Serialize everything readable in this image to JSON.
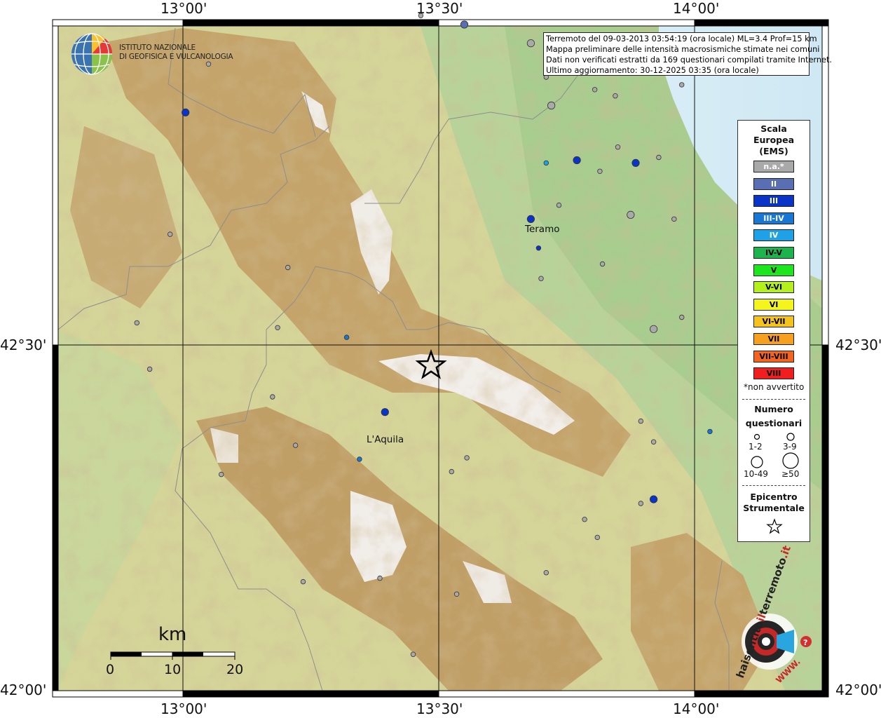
{
  "header": {
    "lines": [
      "Terremoto del 09-03-2013 03:54:19 (ora locale) ML=3.4 Prof=15 km",
      "Mappa preliminare delle intensità macrosismiche stimate nei comuni",
      "Dati non verificati estratti da 169 questionari compilati tramite Internet.",
      "Ultimo aggiornamento: 30-12-2025 03:35 (ora locale)"
    ]
  },
  "institute": {
    "line1": "ISTITUTO NAZIONALE",
    "line2": "DI GEOFISICA E VULCANOLOGIA"
  },
  "axes": {
    "top": [
      "13°00'",
      "13°30'",
      "14°00'"
    ],
    "bottom": [
      "13°00'",
      "13°30'",
      "14°00'"
    ],
    "left": [
      "42°30'",
      "42°00'"
    ],
    "right": [
      "42°30'",
      "42°00'"
    ]
  },
  "cities": [
    {
      "name": "Teramo",
      "lon": 13.703,
      "lat": 42.658
    },
    {
      "name": "L'Aquila",
      "lon": 13.397,
      "lat": 42.35
    }
  ],
  "epicenter": {
    "lon": 13.485,
    "lat": 42.47
  },
  "legend": {
    "scale_title": [
      "Scala",
      "Europea",
      "(EMS)"
    ],
    "classes": [
      {
        "label": "n.a.*",
        "color": "#a9a9a9",
        "text": "#ffffff"
      },
      {
        "label": "II",
        "color": "#5a6eb3",
        "text": "#ffffff"
      },
      {
        "label": "III",
        "color": "#0a34c8",
        "text": "#ffffff"
      },
      {
        "label": "III-IV",
        "color": "#1976d2",
        "text": "#ffffff"
      },
      {
        "label": "IV",
        "color": "#1ea1e6",
        "text": "#ffffff"
      },
      {
        "label": "IV-V",
        "color": "#1db34d",
        "text": "#000000"
      },
      {
        "label": "V",
        "color": "#1ee61e",
        "text": "#000000"
      },
      {
        "label": "V-VI",
        "color": "#b4f01e",
        "text": "#000000"
      },
      {
        "label": "VI",
        "color": "#f5f51e",
        "text": "#000000"
      },
      {
        "label": "VI-VII",
        "color": "#f5c31e",
        "text": "#000000"
      },
      {
        "label": "VII",
        "color": "#f5a01e",
        "text": "#000000"
      },
      {
        "label": "VII-VIII",
        "color": "#f5641e",
        "text": "#000000"
      },
      {
        "label": "VIII",
        "color": "#f01e1e",
        "text": "#000000"
      }
    ],
    "not_felt_note": "*non avvertito",
    "count_title": [
      "Numero",
      "questionari"
    ],
    "count_sizes": [
      "1-2",
      "3-9",
      "10-49",
      "≥50"
    ],
    "epicenter_title": [
      "Epicentro",
      "Strumentale"
    ]
  },
  "scalebar": {
    "unit": "km",
    "ticks": [
      "0",
      "10",
      "20"
    ]
  },
  "watermark": "hai sentito il terremoto.it WWW",
  "map_data": {
    "extent": {
      "lon": [
        12.75,
        14.25
      ],
      "lat": [
        41.99,
        42.67
      ]
    },
    "points": [
      {
        "lon": 13.465,
        "lat": 42.976,
        "cls": "n.a.*",
        "size": "1-2"
      },
      {
        "lon": 13.55,
        "lat": 42.963,
        "cls": "II",
        "size": "3-9"
      },
      {
        "lon": 13.68,
        "lat": 42.936,
        "cls": "n.a.*",
        "size": "3-9"
      },
      {
        "lon": 13.05,
        "lat": 42.906,
        "cls": "n.a.*",
        "size": "1-2"
      },
      {
        "lon": 13.71,
        "lat": 42.887,
        "cls": "n.a.*",
        "size": "1-2"
      },
      {
        "lon": 13.845,
        "lat": 42.86,
        "cls": "n.a.*",
        "size": "1-2"
      },
      {
        "lon": 13.805,
        "lat": 42.869,
        "cls": "n.a.*",
        "size": "1-2"
      },
      {
        "lon": 13.72,
        "lat": 42.846,
        "cls": "n.a.*",
        "size": "3-9"
      },
      {
        "lon": 13.005,
        "lat": 42.836,
        "cls": "III",
        "size": "3-9"
      },
      {
        "lon": 13.975,
        "lat": 42.876,
        "cls": "n.a.*",
        "size": "1-2"
      },
      {
        "lon": 13.85,
        "lat": 42.786,
        "cls": "n.a.*",
        "size": "1-2"
      },
      {
        "lon": 13.93,
        "lat": 42.771,
        "cls": "n.a.*",
        "size": "1-2"
      },
      {
        "lon": 13.77,
        "lat": 42.767,
        "cls": "III",
        "size": "3-9"
      },
      {
        "lon": 13.71,
        "lat": 42.763,
        "cls": "IV",
        "size": "1-2"
      },
      {
        "lon": 13.885,
        "lat": 42.763,
        "cls": "III",
        "size": "3-9"
      },
      {
        "lon": 13.815,
        "lat": 42.751,
        "cls": "n.a.*",
        "size": "1-2"
      },
      {
        "lon": 13.735,
        "lat": 42.702,
        "cls": "n.a.*",
        "size": "1-2"
      },
      {
        "lon": 13.96,
        "lat": 42.682,
        "cls": "n.a.*",
        "size": "1-2"
      },
      {
        "lon": 13.875,
        "lat": 42.688,
        "cls": "n.a.*",
        "size": "3-9"
      },
      {
        "lon": 13.68,
        "lat": 42.682,
        "cls": "III",
        "size": "3-9"
      },
      {
        "lon": 13.695,
        "lat": 42.64,
        "cls": "III",
        "size": "1-2"
      },
      {
        "lon": 12.975,
        "lat": 42.66,
        "cls": "n.a.*",
        "size": "1-2"
      },
      {
        "lon": 13.82,
        "lat": 42.617,
        "cls": "n.a.*",
        "size": "1-2"
      },
      {
        "lon": 13.7,
        "lat": 42.596,
        "cls": "n.a.*",
        "size": "1-2"
      },
      {
        "lon": 13.205,
        "lat": 42.612,
        "cls": "n.a.*",
        "size": "1-2"
      },
      {
        "lon": 13.975,
        "lat": 42.54,
        "cls": "n.a.*",
        "size": "1-2"
      },
      {
        "lon": 13.92,
        "lat": 42.523,
        "cls": "n.a.*",
        "size": "3-9"
      },
      {
        "lon": 12.91,
        "lat": 42.532,
        "cls": "n.a.*",
        "size": "1-2"
      },
      {
        "lon": 13.185,
        "lat": 42.525,
        "cls": "n.a.*",
        "size": "1-2"
      },
      {
        "lon": 13.32,
        "lat": 42.511,
        "cls": "III-IV",
        "size": "1-2"
      },
      {
        "lon": 12.935,
        "lat": 42.465,
        "cls": "n.a.*",
        "size": "1-2"
      },
      {
        "lon": 13.175,
        "lat": 42.425,
        "cls": "n.a.*",
        "size": "1-2"
      },
      {
        "lon": 13.395,
        "lat": 42.403,
        "cls": "III",
        "size": "3-9"
      },
      {
        "lon": 13.895,
        "lat": 42.39,
        "cls": "n.a.*",
        "size": "1-2"
      },
      {
        "lon": 14.03,
        "lat": 42.375,
        "cls": "III-IV",
        "size": "1-2"
      },
      {
        "lon": 13.92,
        "lat": 42.36,
        "cls": "n.a.*",
        "size": "1-2"
      },
      {
        "lon": 13.22,
        "lat": 42.355,
        "cls": "n.a.*",
        "size": "1-2"
      },
      {
        "lon": 13.345,
        "lat": 42.335,
        "cls": "III-IV",
        "size": "1-2"
      },
      {
        "lon": 13.555,
        "lat": 42.337,
        "cls": "n.a.*",
        "size": "1-2"
      },
      {
        "lon": 13.525,
        "lat": 42.317,
        "cls": "n.a.*",
        "size": "1-2"
      },
      {
        "lon": 13.075,
        "lat": 42.313,
        "cls": "n.a.*",
        "size": "1-2"
      },
      {
        "lon": 13.92,
        "lat": 42.277,
        "cls": "III",
        "size": "3-9"
      },
      {
        "lon": 13.895,
        "lat": 42.271,
        "cls": "n.a.*",
        "size": "1-2"
      },
      {
        "lon": 13.785,
        "lat": 42.248,
        "cls": "n.a.*",
        "size": "1-2"
      },
      {
        "lon": 13.81,
        "lat": 42.222,
        "cls": "n.a.*",
        "size": "1-2"
      },
      {
        "lon": 13.71,
        "lat": 42.171,
        "cls": "n.a.*",
        "size": "1-2"
      },
      {
        "lon": 13.235,
        "lat": 42.158,
        "cls": "n.a.*",
        "size": "1-2"
      },
      {
        "lon": 13.385,
        "lat": 42.163,
        "cls": "n.a.*",
        "size": "1-2"
      },
      {
        "lon": 13.535,
        "lat": 42.14,
        "cls": "n.a.*",
        "size": "1-2"
      },
      {
        "lon": 13.45,
        "lat": 42.053,
        "cls": "n.a.*",
        "size": "1-2"
      }
    ]
  }
}
